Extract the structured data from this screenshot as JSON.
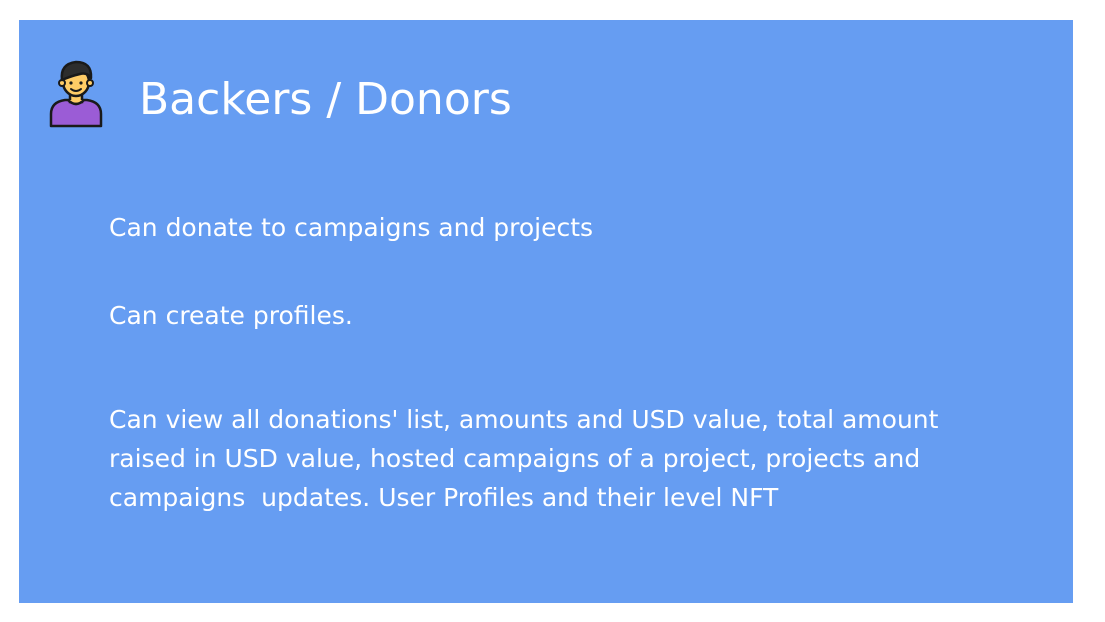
{
  "card": {
    "title": "Backers / Donors",
    "icon": "user-avatar-icon",
    "items": [
      "Can donate to campaigns and projects",
      "Can create profiles.",
      "Can view all donations' list, amounts and USD value, total amount raised in USD value, hosted campaigns of a project, projects and campaigns  updates. User Profiles and their level NFT"
    ]
  },
  "colors": {
    "card_background": "#669df2",
    "text": "#ffffff",
    "avatar_skin": "#ffcc66",
    "avatar_hair": "#2d2d2d",
    "avatar_shirt": "#9b5cd6"
  }
}
